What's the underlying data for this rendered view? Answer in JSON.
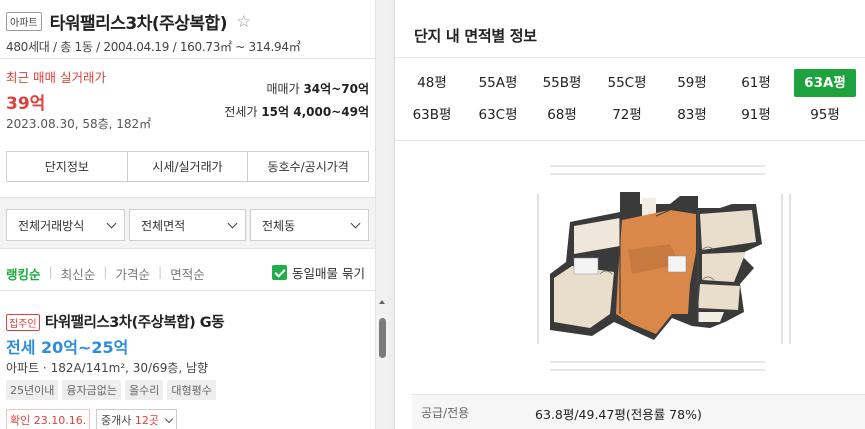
{
  "listing": {
    "badge": "아파트",
    "name": "타워팰리스3차(주상복합)",
    "star": "☆",
    "subinfo": "480세대 / 총 1동 / 2004.04.19 / 160.73㎡ ~ 314.94㎡",
    "recent_label": "최근 매매 실거래가",
    "recent_price": "39억",
    "recent_date": "2023.08.30, 58층, 182㎡",
    "sale_label": "매매가",
    "sale_value": "34억~70억",
    "jeonse_label": "전세가",
    "jeonse_value": "15억 4,000~49억"
  },
  "tabs": [
    "단지정보",
    "시세/실거래가",
    "동호수/공시가격"
  ],
  "filters": [
    "전체거래방식",
    "전체면적",
    "전체동"
  ],
  "sort": {
    "options": [
      "랭킹순",
      "최신순",
      "가격순",
      "면적순"
    ],
    "active_index": 0,
    "group_label": "동일매물 묶기"
  },
  "card": {
    "badge": "집주인",
    "title": "타워팰리스3차(주상복합) G동",
    "price": "전세 20억~25억",
    "spec": "아파트 · 182A/141m², 30/69층, 남향",
    "tags": [
      "25년이내",
      "융자금없는",
      "올수리",
      "대형평수"
    ],
    "confirm": "확인 23.10.16.",
    "agent_prefix": "중개사 ",
    "agent_count": "12곳"
  },
  "right": {
    "title": "단지 내 면적별 정보",
    "pyeong": [
      [
        "48평",
        "55A평",
        "55B평",
        "55C평",
        "59평",
        "61평",
        "63A평"
      ],
      [
        "63B평",
        "63C평",
        "68평",
        "72평",
        "83평",
        "91평",
        "95평"
      ]
    ],
    "active": "63A평",
    "info_label": "공급/전용",
    "info_value": "63.8평/49.47평(전용률 78%)"
  },
  "colors": {
    "accent_green": "#1ea23d",
    "price_red": "#e0403c",
    "price_blue": "#2d8ee0"
  }
}
